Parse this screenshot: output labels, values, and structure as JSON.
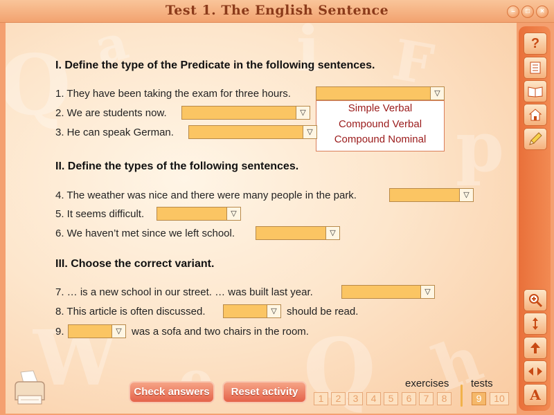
{
  "window": {
    "title": "Test 1. The English Sentence"
  },
  "sections": [
    {
      "heading": "I. Define the type of the Predicate in the following sentences."
    },
    {
      "heading": "II. Define the types of the following sentences."
    },
    {
      "heading": "III. Choose the correct variant."
    }
  ],
  "questions": {
    "q1": "1. They have been taking the exam for three hours.",
    "q2": "2. We are students now.",
    "q3": "3. He can speak German.",
    "q4": "4. The weather was nice and there were many people in the park.",
    "q5": "5. It seems difficult.",
    "q6": "6. We haven’t met since we left school.",
    "q7": "7. … is a new school in our street. … was built last year.",
    "q8a": "8. This article is often discussed.",
    "q8b": "should be read.",
    "q9a": "9.",
    "q9b": "was a sofa and two chairs in the room."
  },
  "dropdown": {
    "arrow": "▽",
    "options": [
      "Simple Verbal",
      "Compound Verbal",
      "Compound Nominal"
    ]
  },
  "buttons": {
    "check": "Check answers",
    "reset": "Reset activity"
  },
  "nav": {
    "exercises_label": "exercises",
    "tests_label": "tests",
    "exercises": [
      "1",
      "2",
      "3",
      "4",
      "5",
      "6",
      "7",
      "8"
    ],
    "tests": [
      "9",
      "10"
    ],
    "active_test": "9"
  },
  "sidebar": {
    "icons": [
      "help-icon",
      "checklist-icon",
      "book-icon",
      "home-icon",
      "pencil-icon",
      "zoom-in-icon",
      "resize-icon",
      "up-arrow-icon",
      "left-right-arrows-icon",
      "font-icon"
    ],
    "font_glyph": "A",
    "help_glyph": "?"
  },
  "colors": {
    "accent": "#e9703a",
    "title": "#8b3a1a",
    "select_fill": "#fbc563",
    "option_text": "#9a1a1a"
  }
}
